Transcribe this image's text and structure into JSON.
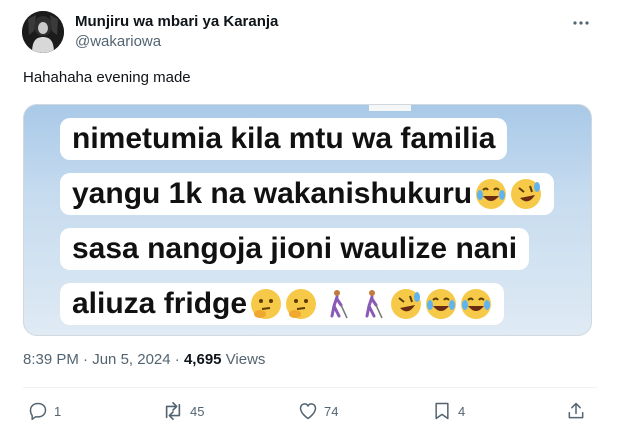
{
  "tweet": {
    "display_name": "Munjiru wa mbari ya Karanja",
    "handle": "@wakariowa",
    "text": "Hahahaha evening made",
    "media": {
      "caption_lines": [
        "nimetumia kila mtu wa familia",
        "yangu 1k na wakanishukuru",
        "sasa nangoja jioni waulize nani",
        "aliuza fridge"
      ],
      "emojis": {
        "line2": [
          "tears-of-joy",
          "rofl"
        ],
        "line4": [
          "thinking",
          "thinking",
          "person-with-white-cane",
          "person-with-white-cane",
          "rofl",
          "tears-of-joy",
          "tears-of-joy"
        ]
      }
    },
    "time": "8:39 PM",
    "separator": "·",
    "date": "Jun 5, 2024",
    "views_count": "4,695",
    "views_label": "Views",
    "actions": {
      "replies": "1",
      "reposts": "45",
      "likes": "74",
      "bookmarks": "4"
    }
  },
  "colors": {
    "text_primary": "#0f1419",
    "text_secondary": "#536471",
    "divider": "#eff3f4",
    "border": "#cfd9de"
  }
}
